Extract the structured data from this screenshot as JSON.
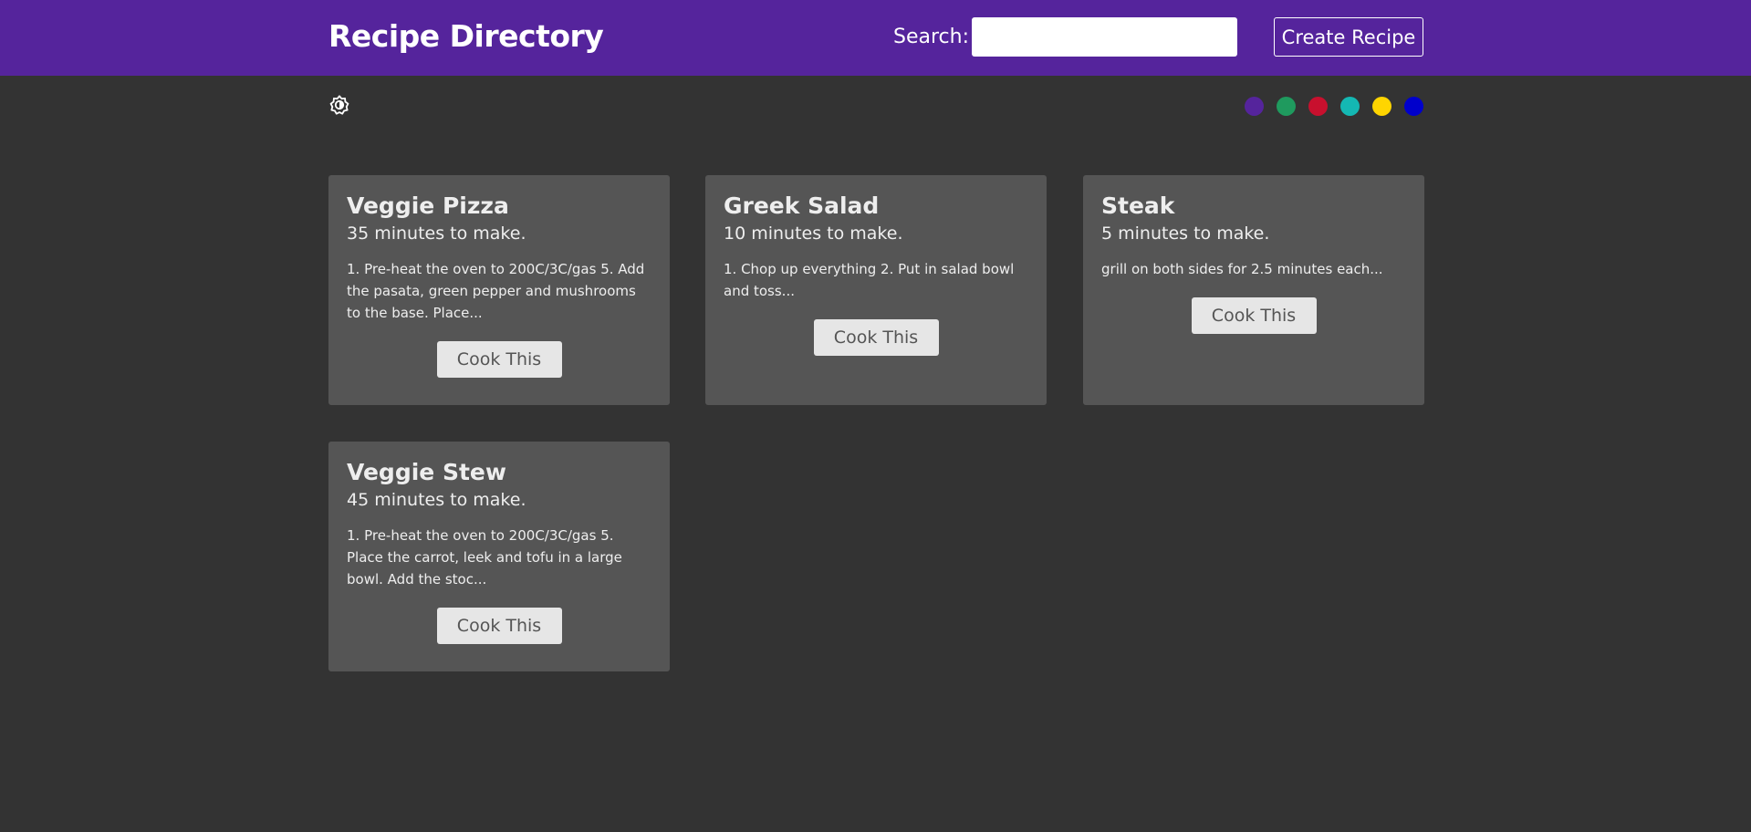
{
  "header": {
    "title": "Recipe Directory",
    "search_label": "Search:",
    "search_value": "",
    "search_placeholder": "",
    "create_label": "Create Recipe"
  },
  "toolbar": {
    "theme_icon": "brightness-icon",
    "swatch_colors": [
      "#55249c",
      "#1f9a5e",
      "#c8102e",
      "#14b8b3",
      "#ffd500",
      "#0000cc"
    ]
  },
  "recipes": [
    {
      "title": "Veggie Pizza",
      "time": "35 minutes to make.",
      "description": "1. Pre-heat the oven to 200C/3C/gas 5. Add the pasata, green pepper and mushrooms to the base. Place...",
      "button": "Cook This"
    },
    {
      "title": "Greek Salad",
      "time": "10 minutes to make.",
      "description": "1. Chop up everything 2. Put in salad bowl and toss...",
      "button": "Cook This"
    },
    {
      "title": "Steak",
      "time": "5 minutes to make.",
      "description": "grill on both sides for 2.5 minutes each...",
      "button": "Cook This"
    },
    {
      "title": "Veggie Stew",
      "time": "45 minutes to make.",
      "description": "1. Pre-heat the oven to 200C/3C/gas 5. Place the carrot, leek and tofu in a large bowl. Add the stoc...",
      "button": "Cook This"
    }
  ]
}
